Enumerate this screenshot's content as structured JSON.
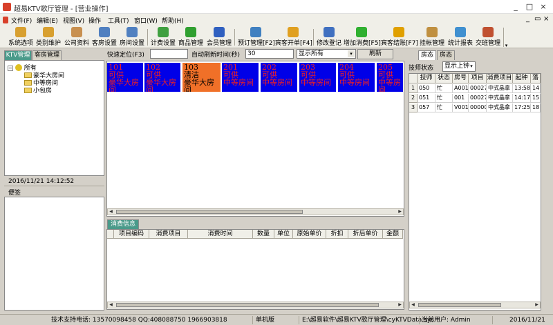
{
  "window": {
    "title": "超易KTV歌厅管理 - [营业操作]",
    "min": "_",
    "max": "□",
    "close": "×",
    "restore": "▭"
  },
  "menu": [
    "文件(F)",
    "编辑(E)",
    "视图(V)",
    "操作",
    "工具(T)",
    "窗口(W)",
    "帮助(H)"
  ],
  "toolbar": [
    {
      "label": "系统选项",
      "icon": "key-icon",
      "color": "#d8a030"
    },
    {
      "label": "类别维护",
      "icon": "key-icon",
      "color": "#d8a030"
    },
    {
      "label": "公司资料",
      "icon": "book-icon",
      "color": "#c89050"
    },
    {
      "label": "客房设置",
      "icon": "building-icon",
      "color": "#5080c0"
    },
    {
      "label": "房间设置",
      "icon": "building-icon",
      "color": "#5080c0"
    },
    {
      "label": "计费设置",
      "icon": "money-icon",
      "color": "#40a040"
    },
    {
      "label": "商品管理",
      "icon": "goods-icon",
      "color": "#30a030"
    },
    {
      "label": "会员管理",
      "icon": "user-icon",
      "color": "#3060c0"
    },
    {
      "label": "预订管理[F2]",
      "icon": "phone-icon",
      "color": "#4080c0"
    },
    {
      "label": "宾客开单[F4]",
      "icon": "box-icon",
      "color": "#e0a020"
    },
    {
      "label": "修改登记",
      "icon": "edit-user-icon",
      "color": "#4070c0"
    },
    {
      "label": "增加消费[F5]",
      "icon": "add-icon",
      "color": "#30b030"
    },
    {
      "label": "宾客结账[F7]",
      "icon": "coin-icon",
      "color": "#e0a000"
    },
    {
      "label": "挂帐管理",
      "icon": "bag-icon",
      "color": "#c09040"
    },
    {
      "label": "统计报表",
      "icon": "chart-icon",
      "color": "#4090d0"
    },
    {
      "label": "交班管理",
      "icon": "users-icon",
      "color": "#c05030"
    }
  ],
  "left": {
    "tabs": [
      "KTV管理",
      "客房管理"
    ],
    "tree": {
      "root": "所有",
      "items": [
        "豪华大房间",
        "中等房间",
        "小包房"
      ]
    },
    "datetime": "2016/11/21  14:12:52",
    "notes_label": "便签"
  },
  "search": {
    "label": "快速定位(F3)",
    "value": "",
    "refresh_label": "自动刷新时间(秒)",
    "refresh_value": "30",
    "filter": "显示所有",
    "refresh_button": "刷新"
  },
  "rooms": [
    {
      "no": "101",
      "status": "可供",
      "type": "豪华大房间",
      "style": "blue"
    },
    {
      "no": "102",
      "status": "可供",
      "type": "豪华大房间",
      "style": "blue"
    },
    {
      "no": "103",
      "status": "清洁",
      "type": "豪华大房间",
      "style": "orange"
    },
    {
      "no": "201",
      "status": "可供",
      "type": "中等房间",
      "style": "blue"
    },
    {
      "no": "202",
      "status": "可供",
      "type": "中等房间",
      "style": "blue"
    },
    {
      "no": "203",
      "status": "可供",
      "type": "中等房间",
      "style": "blue"
    },
    {
      "no": "204",
      "status": "可供",
      "type": "中等房间",
      "style": "blue"
    },
    {
      "no": "205",
      "status": "可供",
      "type": "中等房间",
      "style": "blue"
    }
  ],
  "consume": {
    "tab": "消费信息",
    "columns": [
      "项目编码",
      "消费项目",
      "消费时间",
      "数量",
      "单位",
      "原始单价",
      "折扣",
      "折后单价",
      "金额"
    ]
  },
  "right": {
    "tabs": [
      "房态",
      "房态"
    ],
    "tech_label": "技师状态",
    "tech_filter": "显示上钟",
    "columns": [
      "技师",
      "状态",
      "房号",
      "项目",
      "消费项目",
      "起钟",
      "落"
    ],
    "rows": [
      {
        "n": "1",
        "cells": [
          "050",
          "忙",
          "A001",
          "00027",
          "中式晶拿",
          "13:58",
          "14:"
        ]
      },
      {
        "n": "2",
        "cells": [
          "051",
          "忙",
          "001",
          "00027",
          "中式晶拿",
          "14:17",
          "15:"
        ]
      },
      {
        "n": "3",
        "cells": [
          "057",
          "忙",
          "V001",
          "00000",
          "中式晶拿",
          "17:25",
          "18:"
        ]
      }
    ]
  },
  "status": {
    "support": "技术支持电话: 13570098458 QQ:408088750 1966903818",
    "edition": "单机版",
    "path": "E:\\超易软件\\超易KTV歌厅管理\\cyKTVData.sys",
    "user": "当前用户: Admin",
    "date": "2016/11/21"
  }
}
